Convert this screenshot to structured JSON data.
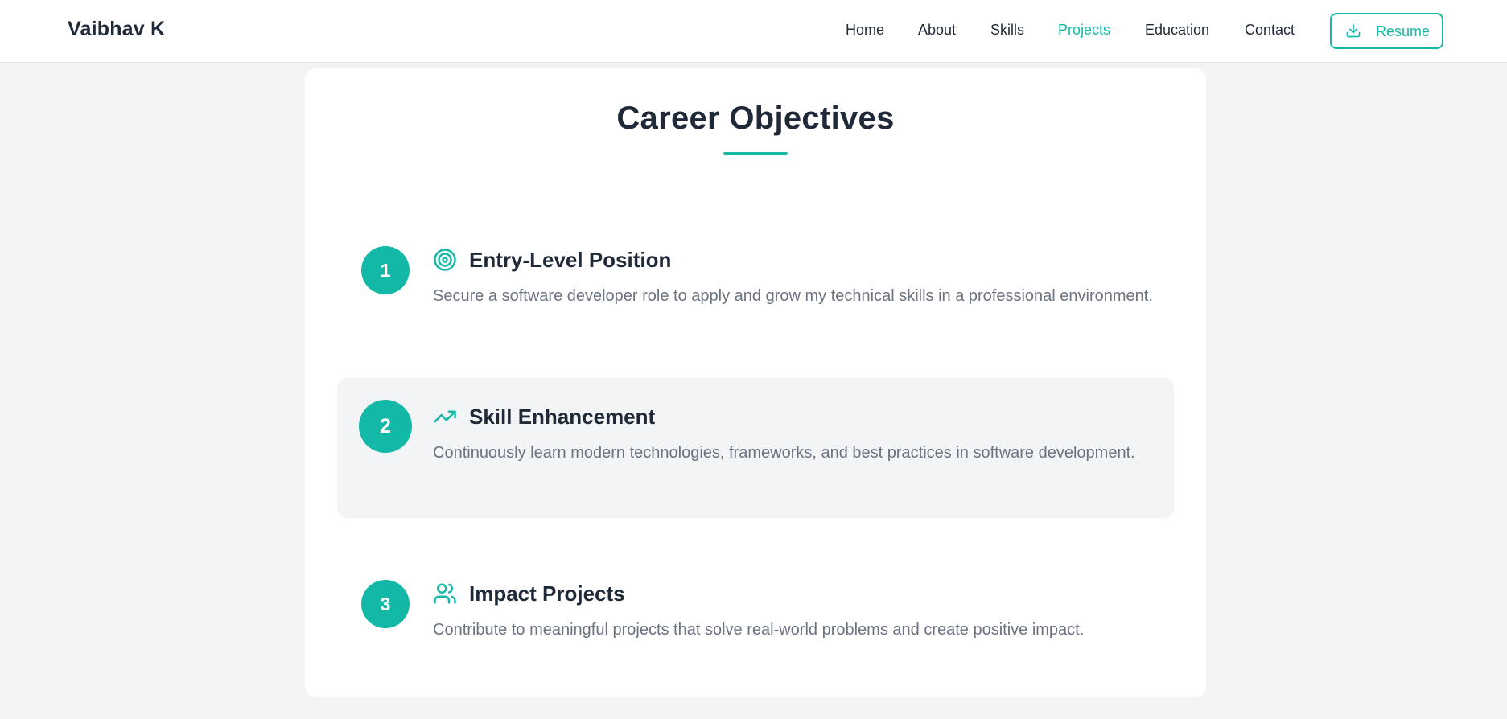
{
  "header": {
    "brand": "Vaibhav K",
    "nav": [
      {
        "label": "Home",
        "active": false
      },
      {
        "label": "About",
        "active": false
      },
      {
        "label": "Skills",
        "active": false
      },
      {
        "label": "Projects",
        "active": true
      },
      {
        "label": "Education",
        "active": false
      },
      {
        "label": "Contact",
        "active": false
      }
    ],
    "resume_label": "Resume",
    "resume_icon": "download-icon"
  },
  "section": {
    "title": "Career Objectives",
    "objectives": [
      {
        "number": "1",
        "icon": "target-icon",
        "title": "Entry-Level Position",
        "description": "Secure a software developer role to apply and grow my technical skills in a professional environment."
      },
      {
        "number": "2",
        "icon": "trending-up-icon",
        "title": "Skill Enhancement",
        "description": "Continuously learn modern technologies, frameworks, and best practices in software development."
      },
      {
        "number": "3",
        "icon": "users-icon",
        "title": "Impact Projects",
        "description": "Contribute to meaningful projects that solve real-world problems and create positive impact."
      }
    ]
  },
  "colors": {
    "accent": "#14b8a6",
    "text_dark": "#1f2937",
    "text_muted": "#6b7280",
    "page_bg": "#f3f4f6"
  }
}
